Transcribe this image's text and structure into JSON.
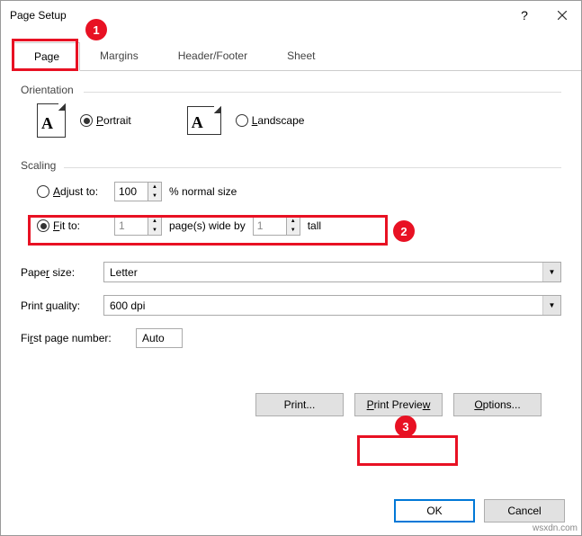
{
  "title": "Page Setup",
  "tabs": {
    "page": "Page",
    "margins": "Margins",
    "headerfooter": "Header/Footer",
    "sheet": "Sheet"
  },
  "orientation": {
    "label": "Orientation",
    "portrait": "Portrait",
    "landscape": "Landscape",
    "iconA": "A"
  },
  "scaling": {
    "label": "Scaling",
    "adjust_pre": "A",
    "adjust_post": "djust to:",
    "adjust_value": "100",
    "adjust_suffix": "% normal size",
    "fit_pre": "F",
    "fit_post": "it to:",
    "fit_wide": "1",
    "fit_mid": "page(s) wide by",
    "fit_tall": "1",
    "fit_suffix": "tall"
  },
  "paper": {
    "label_pre": "Pape",
    "label_u": "r",
    "label_post": " size:",
    "value": "Letter"
  },
  "quality": {
    "label": "Print ",
    "label_u": "q",
    "label_post": "uality:",
    "value": "600 dpi"
  },
  "firstpage": {
    "label": "Fi",
    "label_u": "r",
    "label_post": "st page number:",
    "value": "Auto"
  },
  "buttons": {
    "print": "Print...",
    "preview": "Print Preview",
    "options": "Options...",
    "ok": "OK",
    "cancel": "Cancel"
  },
  "badges": {
    "b1": "1",
    "b2": "2",
    "b3": "3"
  },
  "watermark": "wsxdn.com"
}
